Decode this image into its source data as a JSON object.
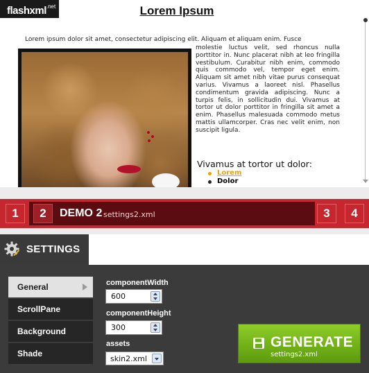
{
  "preview": {
    "logo": {
      "name": "flashxml",
      "tld": ".net"
    },
    "title": "Lorem Ipsum",
    "lead": "Lorem ipsum dolor sit amet, consectetur adipiscing elit. Aliquam et aliquam enim. Fusce",
    "body_text": "molestie luctus velit, sed rhoncus nulla porttitor in. Nunc placerat nibh at leo fringilla vestibulum. Curabitur nibh enim, commodo quis commodo vel, tempor eget enim. Aliquam sit amet nibh vitae purus consequat varius. Vivamus a laoreet nisl. Phasellus condimentum gravida adipiscing. Nunc a turpis felis, in sollicitudin dui. Vivamus at tortor ut dolor porttitor in fringilla sit amet a enim. Phasellus malesuada commodo metus mattis ullamcorper. Cras nec velit enim, non suscipit ligula.",
    "sub_heading": "Vivamus at tortor ut dolor:",
    "bullets": [
      "Lorem",
      "Dolor"
    ]
  },
  "demo_bar": {
    "buttons": [
      "1",
      "2",
      "3",
      "4"
    ],
    "title": "DEMO 2",
    "file": "settings2.xml"
  },
  "settings": {
    "title": "SETTINGS",
    "menu": [
      "General",
      "ScrollPane",
      "Background",
      "Shade"
    ],
    "fields": {
      "component_width": {
        "label": "componentWidth",
        "value": "600"
      },
      "component_height": {
        "label": "componentHeight",
        "value": "300"
      },
      "assets": {
        "label": "assets",
        "value": "skin2.xml"
      }
    },
    "generate": {
      "label": "GENERATE",
      "sub": "settings2.xml"
    }
  },
  "colors": {
    "demo_red": "#c6262e",
    "demo_dark": "#5b0c10",
    "panel_bg": "#3b3b3b",
    "generate_green": "#6faf16",
    "link_orange": "#f0a000"
  }
}
